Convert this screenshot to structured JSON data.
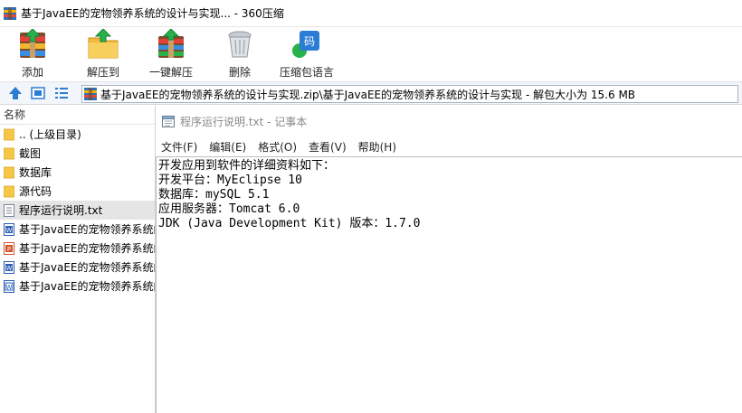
{
  "window": {
    "title": "基于JavaEE的宠物领养系统的设计与实现... - 360压缩"
  },
  "toolbar": {
    "add_label": "添加",
    "extract_label": "解压到",
    "oneclick_label": "一键解压",
    "delete_label": "删除",
    "language_label": "压缩包语言"
  },
  "address": {
    "path": "基于JavaEE的宠物领养系统的设计与实现.zip\\基于JavaEE的宠物领养系统的设计与实现 - 解包大小为 15.6 MB"
  },
  "filelist": {
    "header": "名称",
    "items": [
      {
        "name": ".. (上级目录)",
        "icon": "folder-icon"
      },
      {
        "name": "截图",
        "icon": "folder-icon"
      },
      {
        "name": "数据库",
        "icon": "folder-icon"
      },
      {
        "name": "源代码",
        "icon": "folder-icon"
      },
      {
        "name": "程序运行说明.txt",
        "icon": "text-file-icon"
      },
      {
        "name": "基于JavaEE的宠物领养系统的",
        "icon": "word-doc-icon"
      },
      {
        "name": "基于JavaEE的宠物领养系统的",
        "icon": "ppt-file-icon"
      },
      {
        "name": "基于JavaEE的宠物领养系统的",
        "icon": "word-doc-icon"
      },
      {
        "name": "基于JavaEE的宠物领养系统的",
        "icon": "word-doc-icon"
      }
    ]
  },
  "notepad": {
    "title": "程序运行说明.txt - 记事本",
    "menu": [
      "文件(F)",
      "编辑(E)",
      "格式(O)",
      "查看(V)",
      "帮助(H)"
    ],
    "lines": [
      "开发应用到软件的详细资料如下：",
      "开发平台：MyEclipse 10",
      "数据库：mySQL 5.1",
      "应用服务器：Tomcat 6.0",
      "JDK (Java Development Kit) 版本：1.7.0"
    ]
  },
  "colors": {
    "folder": "#f6c746",
    "word": "#2b5eb5",
    "ppt": "#d0542c",
    "accent": "#2b7cd3"
  }
}
